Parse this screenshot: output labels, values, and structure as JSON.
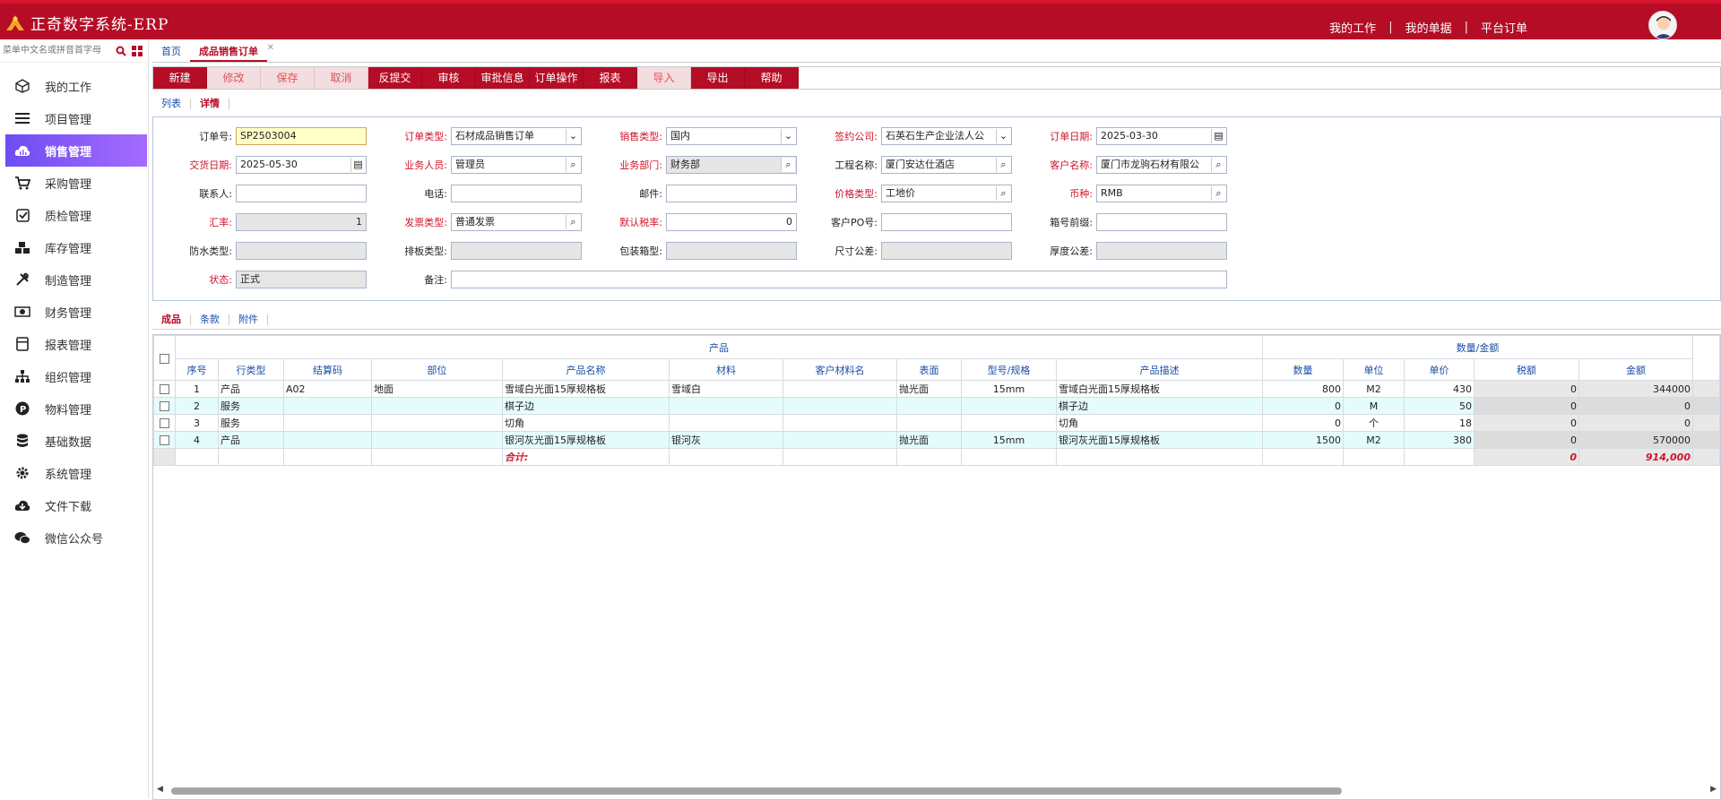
{
  "app": {
    "title": "正奇数字系统-ERP"
  },
  "topnav": {
    "my_work": "我的工作",
    "my_docs": "我的单据",
    "platform_orders": "平台订单"
  },
  "sidebar": {
    "search_placeholder": "菜单中文名或拼音首字母",
    "items": [
      {
        "label": "我的工作",
        "icon": "cube-icon"
      },
      {
        "label": "项目管理",
        "icon": "list-icon"
      },
      {
        "label": "销售管理",
        "icon": "cloud-icon",
        "active": true
      },
      {
        "label": "采购管理",
        "icon": "cart-icon"
      },
      {
        "label": "质检管理",
        "icon": "check-icon"
      },
      {
        "label": "库存管理",
        "icon": "boxes-icon"
      },
      {
        "label": "制造管理",
        "icon": "tools-icon"
      },
      {
        "label": "财务管理",
        "icon": "money-icon"
      },
      {
        "label": "报表管理",
        "icon": "report-icon"
      },
      {
        "label": "组织管理",
        "icon": "org-icon"
      },
      {
        "label": "物料管理",
        "icon": "p-circle-icon"
      },
      {
        "label": "基础数据",
        "icon": "database-icon"
      },
      {
        "label": "系统管理",
        "icon": "gear-icon"
      },
      {
        "label": "文件下载",
        "icon": "cloud-download-icon"
      },
      {
        "label": "微信公众号",
        "icon": "wechat-icon"
      }
    ]
  },
  "tabs": {
    "home": "首页",
    "current": "成品销售订单"
  },
  "toolbar": [
    "新建",
    "修改",
    "保存",
    "取消",
    "反提交",
    "审核",
    "审批信息",
    "订单操作",
    "报表",
    "导入",
    "导出",
    "帮助"
  ],
  "toolbar_disabled": [
    1,
    2,
    3,
    9
  ],
  "subtabs": {
    "list": "列表",
    "detail": "详情"
  },
  "form": {
    "order_no": {
      "label": "订单号:",
      "value": "SP2503004"
    },
    "order_type": {
      "label": "订单类型:",
      "value": "石材成品销售订单"
    },
    "sales_type": {
      "label": "销售类型:",
      "value": "国内"
    },
    "sign_company": {
      "label": "签约公司:",
      "value": "石英石生产企业法人公"
    },
    "order_date": {
      "label": "订单日期:",
      "value": "2025-03-30"
    },
    "delivery_date": {
      "label": "交货日期:",
      "value": "2025-05-30"
    },
    "salesman": {
      "label": "业务人员:",
      "value": "管理员"
    },
    "dept": {
      "label": "业务部门:",
      "value": "财务部"
    },
    "project": {
      "label": "工程名称:",
      "value": "厦门安达仕酒店"
    },
    "customer": {
      "label": "客户名称:",
      "value": "厦门市龙驹石材有限公"
    },
    "contact": {
      "label": "联系人:",
      "value": ""
    },
    "phone": {
      "label": "电话:",
      "value": ""
    },
    "email": {
      "label": "邮件:",
      "value": ""
    },
    "price_type": {
      "label": "价格类型:",
      "value": "工地价"
    },
    "currency": {
      "label": "币种:",
      "value": "RMB"
    },
    "rate": {
      "label": "汇率:",
      "value": "1"
    },
    "invoice_type": {
      "label": "发票类型:",
      "value": "普通发票"
    },
    "tax_rate": {
      "label": "默认税率:",
      "value": "0"
    },
    "customer_po": {
      "label": "客户PO号:",
      "value": ""
    },
    "box_prefix": {
      "label": "箱号前缀:",
      "value": ""
    },
    "waterproof": {
      "label": "防水类型:",
      "value": ""
    },
    "layout_type": {
      "label": "排板类型:",
      "value": ""
    },
    "pack_type": {
      "label": "包装箱型:",
      "value": ""
    },
    "size_tol": {
      "label": "尺寸公差:",
      "value": ""
    },
    "thick_tol": {
      "label": "厚度公差:",
      "value": ""
    },
    "status": {
      "label": "状态:",
      "value": "正式"
    },
    "remark": {
      "label": "备注:",
      "value": ""
    }
  },
  "bottabs": {
    "product": "成品",
    "terms": "条款",
    "attach": "附件"
  },
  "grid": {
    "group_product": "产品",
    "group_amount": "数量/金额",
    "headers": [
      "序号",
      "行类型",
      "结算码",
      "部位",
      "产品名称",
      "材料",
      "客户材料名",
      "表面",
      "型号/规格",
      "产品描述",
      "数量",
      "单位",
      "单价",
      "税额",
      "金额"
    ],
    "rows": [
      [
        "1",
        "产品",
        "A02",
        "地面",
        "雪域白光面15厚规格板",
        "雪域白",
        "",
        "抛光面",
        "15mm",
        "雪域白光面15厚规格板",
        "800",
        "M2",
        "430",
        "0",
        "344000"
      ],
      [
        "2",
        "服务",
        "",
        "",
        "棋子边",
        "",
        "",
        "",
        "",
        "棋子边",
        "0",
        "M",
        "50",
        "0",
        "0"
      ],
      [
        "3",
        "服务",
        "",
        "",
        "切角",
        "",
        "",
        "",
        "",
        "切角",
        "0",
        "个",
        "18",
        "0",
        "0"
      ],
      [
        "4",
        "产品",
        "",
        "",
        "银河灰光面15厚规格板",
        "银河灰",
        "",
        "抛光面",
        "15mm",
        "银河灰光面15厚规格板",
        "1500",
        "M2",
        "380",
        "0",
        "570000"
      ]
    ],
    "sum_label": "合计:",
    "sum_tax": "0",
    "sum_amount": "914,000"
  },
  "colors": {
    "brand": "#b50d26",
    "active_menu": "#8a5cf6",
    "link": "#1a4ea8"
  }
}
